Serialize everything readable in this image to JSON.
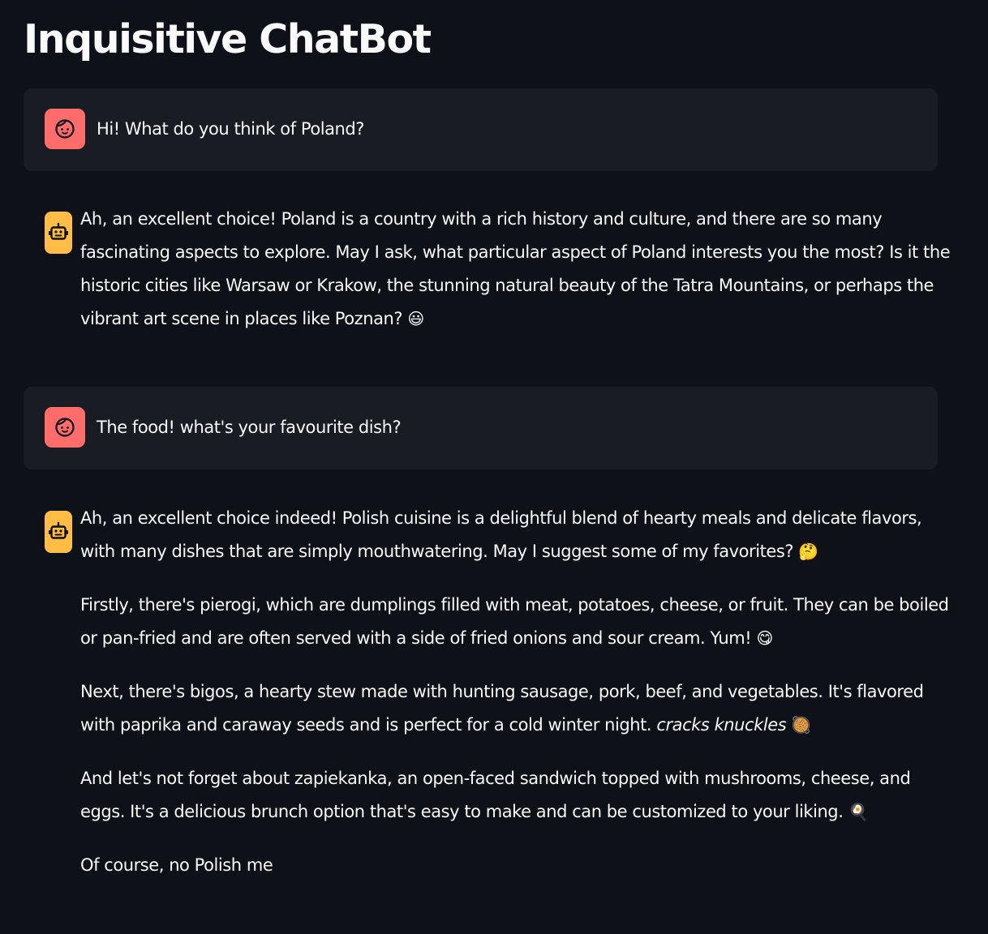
{
  "app": {
    "title": "Inquisitive ChatBot"
  },
  "colors": {
    "background": "#0e1117",
    "user_message_bg": "#1a1c24",
    "user_avatar": "#ff6c6c",
    "bot_avatar": "#ffbd45",
    "text": "#fafafa"
  },
  "messages": [
    {
      "role": "user",
      "avatar_icon": "user-face-icon",
      "text": "Hi! What do you think of Poland?"
    },
    {
      "role": "assistant",
      "avatar_icon": "robot-icon",
      "paragraphs": [
        {
          "text": "Ah, an excellent choice! Poland is a country with a rich history and culture, and there are so many fascinating aspects to explore. May I ask, what particular aspect of Poland interests you the most? Is it the historic cities like Warsaw or Krakow, the stunning natural beauty of the Tatra Mountains, or perhaps the vibrant art scene in places like Poznan?",
          "emoji": "😃"
        }
      ]
    },
    {
      "role": "user",
      "avatar_icon": "user-face-icon",
      "text": "The food! what's your favourite dish?"
    },
    {
      "role": "assistant",
      "avatar_icon": "robot-icon",
      "paragraphs": [
        {
          "text": "Ah, an excellent choice indeed! Polish cuisine is a delightful blend of hearty meals and delicate flavors, with many dishes that are simply mouthwatering. May I suggest some of my favorites?",
          "emoji": "🤔"
        },
        {
          "text": "Firstly, there's pierogi, which are dumplings filled with meat, potatoes, cheese, or fruit. They can be boiled or pan-fried and are often served with a side of fried onions and sour cream. Yum!",
          "emoji": "😋"
        },
        {
          "text": "Next, there's bigos, a hearty stew made with hunting sausage, pork, beef, and vegetables. It's flavored with paprika and caraway seeds and is perfect for a cold winter night.",
          "italic": "cracks knuckles",
          "emoji": "🥘"
        },
        {
          "text": "And let's not forget about zapiekanka, an open-faced sandwich topped with mushrooms, cheese, and eggs. It's a delicious brunch option that's easy to make and can be customized to your liking.",
          "emoji": "🍳"
        },
        {
          "text": "Of course, no Polish me"
        }
      ]
    }
  ]
}
